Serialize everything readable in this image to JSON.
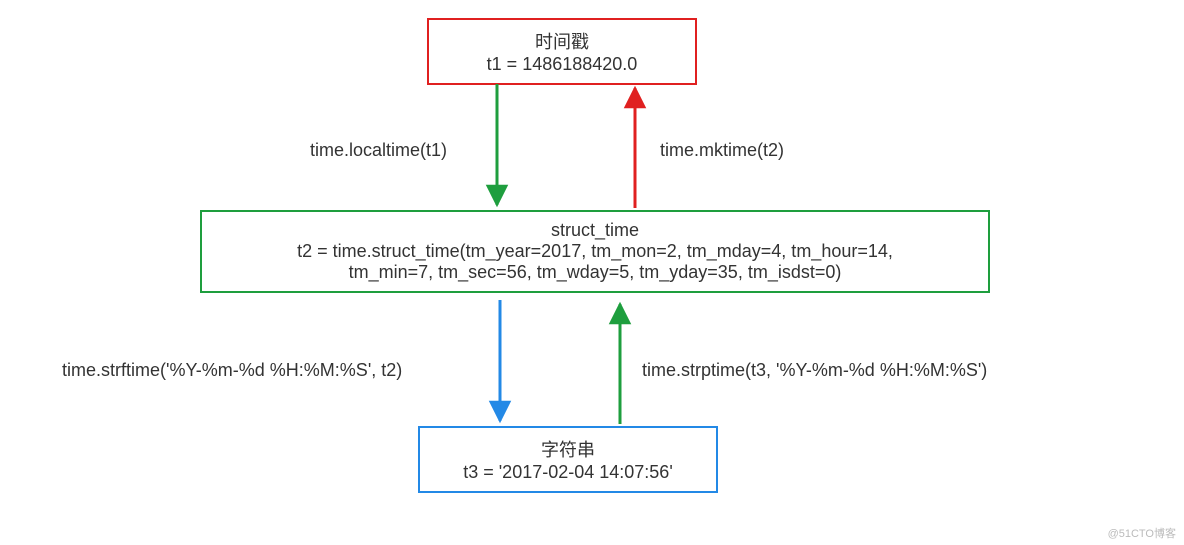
{
  "boxes": {
    "timestamp": {
      "title": "时间戳",
      "value": "t1 = 1486188420.0"
    },
    "struct_time": {
      "title": "struct_time",
      "line1": "t2 = time.struct_time(tm_year=2017, tm_mon=2, tm_mday=4, tm_hour=14,",
      "line2": "tm_min=7, tm_sec=56, tm_wday=5, tm_yday=35, tm_isdst=0)"
    },
    "string": {
      "title": "字符串",
      "value": "t3 = '2017-02-04 14:07:56'"
    }
  },
  "labels": {
    "localtime": "time.localtime(t1)",
    "mktime": "time.mktime(t2)",
    "strftime": "time.strftime('%Y-%m-%d %H:%M:%S', t2)",
    "strptime": "time.strptime(t3, '%Y-%m-%d %H:%M:%S')"
  },
  "watermark": "@51CTO博客"
}
